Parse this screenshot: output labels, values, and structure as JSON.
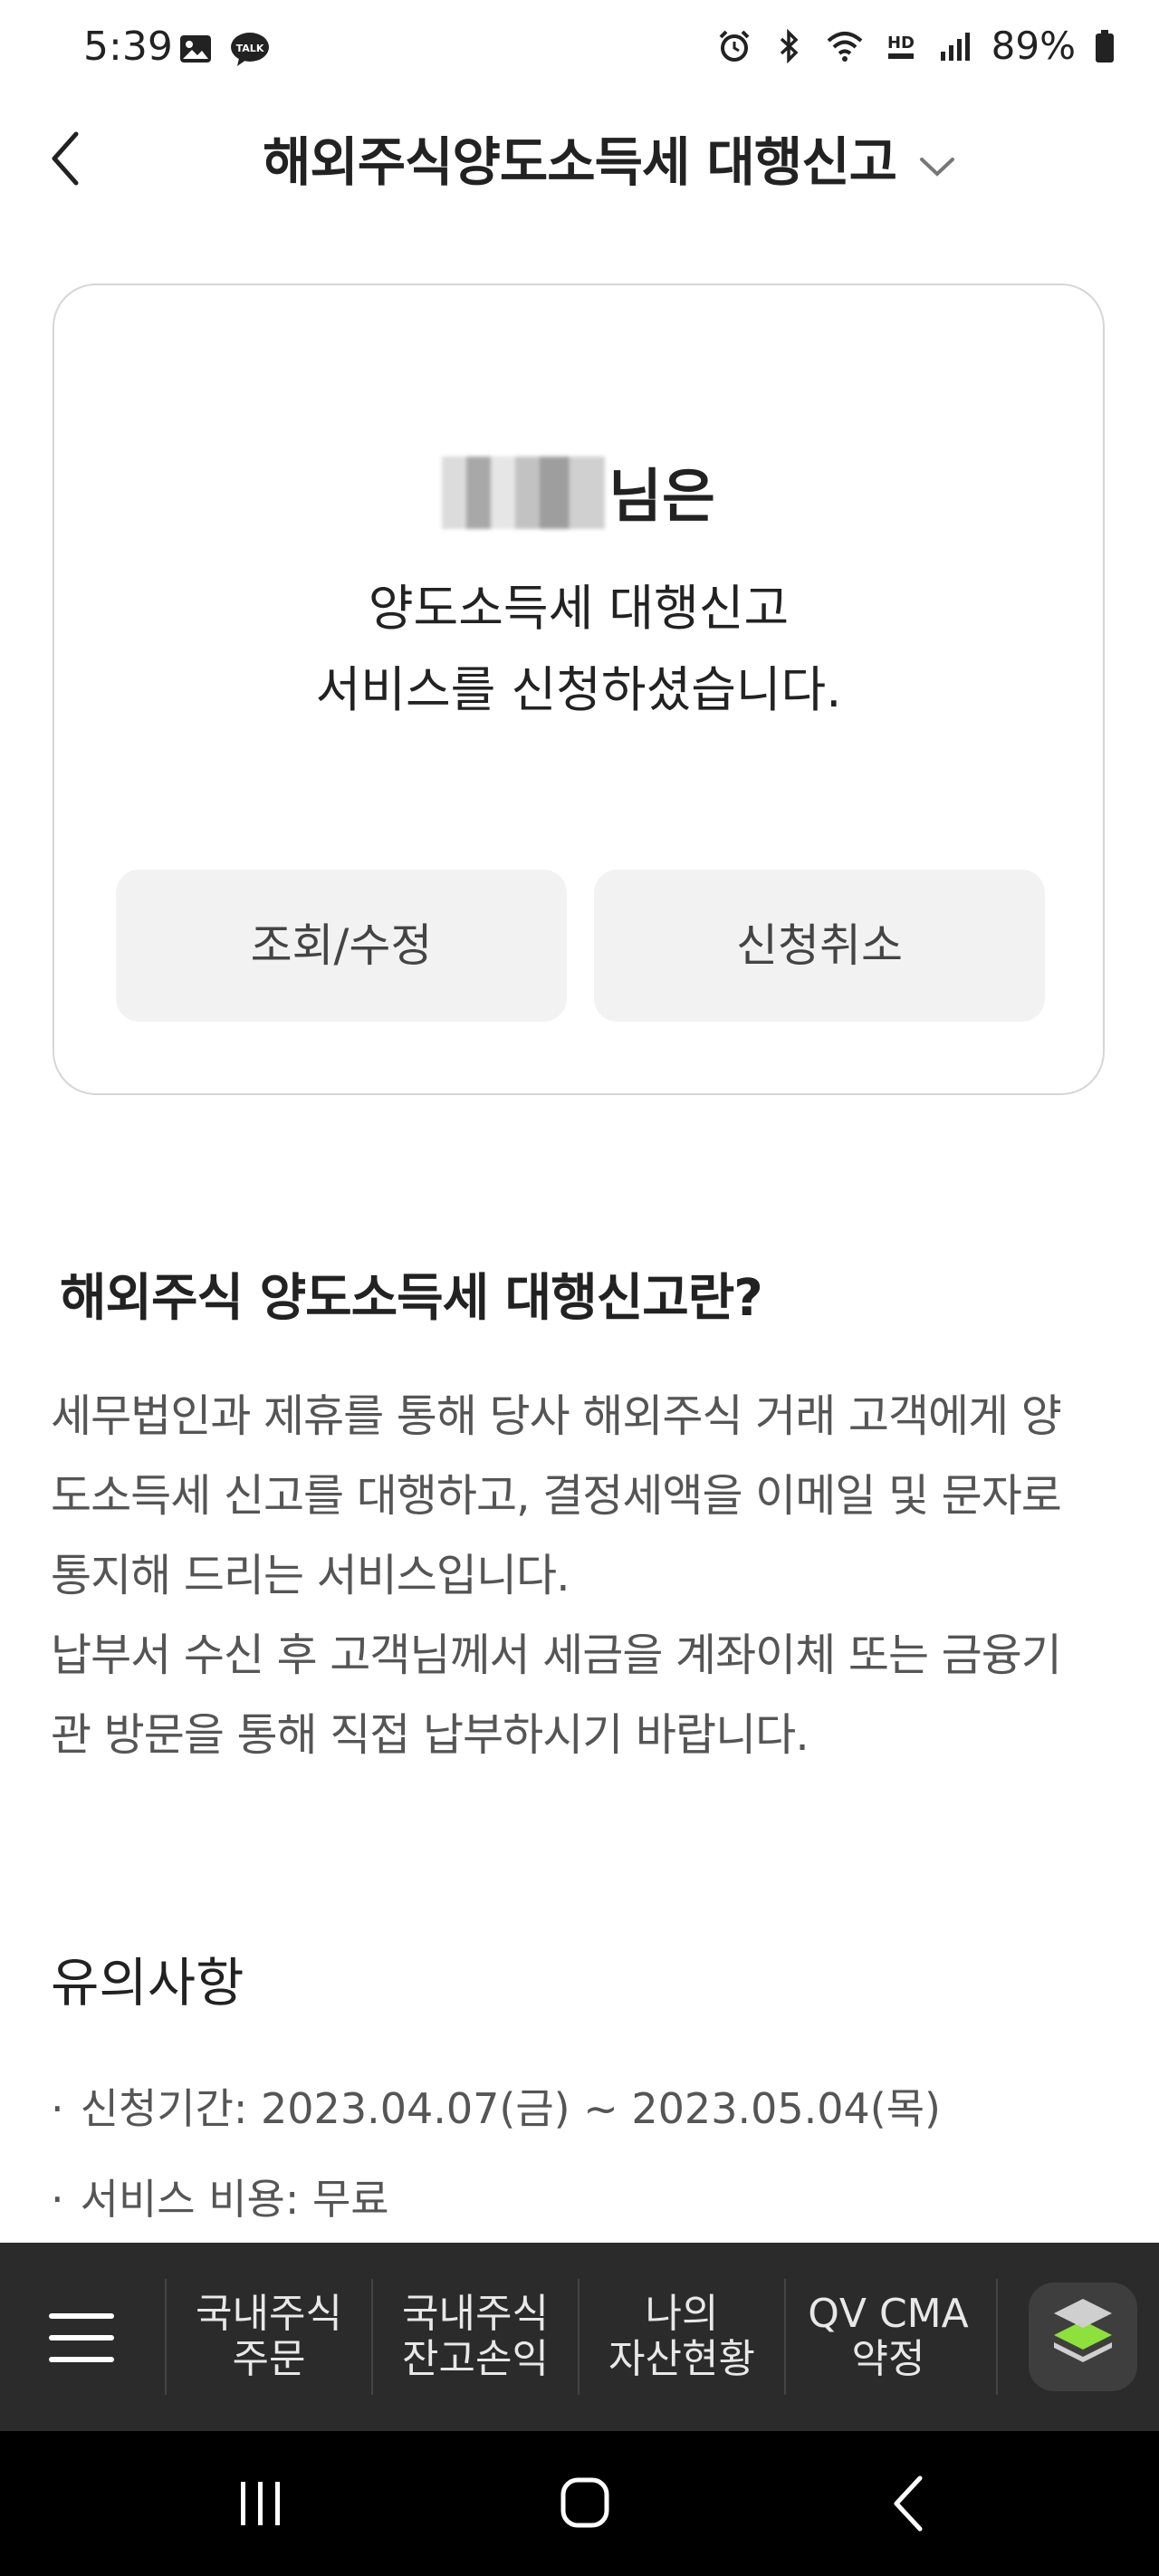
{
  "status_bar": {
    "time": "5:39",
    "battery": "89%",
    "icons": [
      "gallery-icon",
      "talk-icon",
      "alarm-icon",
      "bluetooth-icon",
      "wifi-icon",
      "hd-voice-icon",
      "signal-icon",
      "battery-icon"
    ],
    "talk_label": "TALK",
    "hd_label": "HD"
  },
  "header": {
    "title": "해외주식양도소득세 대행신고"
  },
  "card": {
    "name_suffix": "님은",
    "message_line1": "양도소득세 대행신고",
    "message_line2": "서비스를 신청하셨습니다.",
    "btn_view": "조회/수정",
    "btn_cancel": "신청취소"
  },
  "info": {
    "title": "해외주식 양도소득세 대행신고란?",
    "lines": [
      "세무법인과 제휴를 통해 당사 해외주식 거래 고객에게 양",
      "도소득세 신고를 대행하고, 결정세액을 이메일 및 문자로",
      "통지해 드리는 서비스입니다.",
      "납부서 수신 후 고객님께서 세금을 계좌이체 또는 금융기",
      "관 방문을 통해 직접 납부하시기 바랍니다."
    ]
  },
  "notes": {
    "title": "유의사항",
    "items": [
      "신청기간: 2023.04.07(금) ~ 2023.05.04(목)",
      "서비스 비용: 무료"
    ]
  },
  "bottom_nav": {
    "items": [
      {
        "line1": "국내주식",
        "line2": "주문"
      },
      {
        "line1": "국내주식",
        "line2": "잔고손익"
      },
      {
        "line1": "나의",
        "line2": "자산현황"
      },
      {
        "line1": "QV CMA",
        "line2": "약정"
      }
    ]
  }
}
